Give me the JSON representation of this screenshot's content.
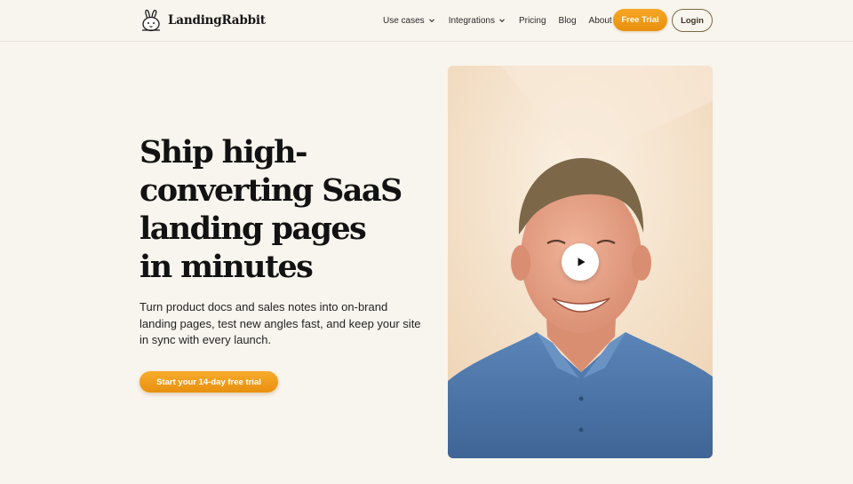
{
  "brand": {
    "name": "LandingRabbit",
    "logo_icon": "rabbit-icon"
  },
  "nav": {
    "items": [
      {
        "label": "Use cases",
        "has_dropdown": true
      },
      {
        "label": "Integrations",
        "has_dropdown": true
      },
      {
        "label": "Pricing",
        "has_dropdown": false
      },
      {
        "label": "Blog",
        "has_dropdown": false
      },
      {
        "label": "About",
        "has_dropdown": false
      }
    ],
    "trial_label": "Free Trial",
    "login_label": "Login"
  },
  "hero": {
    "headline_lines": [
      "Ship high-",
      "converting SaaS",
      "landing pages",
      "in minutes"
    ],
    "subtext": "Turn product docs and sales notes into on-brand landing pages, test new angles fast, and keep your site in sync with every launch.",
    "cta_label": "Start your 14-day free trial"
  },
  "video": {
    "play_icon": "play-icon"
  },
  "colors": {
    "background": "#f8f4ee",
    "accent": "#f29b17",
    "text": "#121212",
    "login_border": "#7b6a45"
  }
}
